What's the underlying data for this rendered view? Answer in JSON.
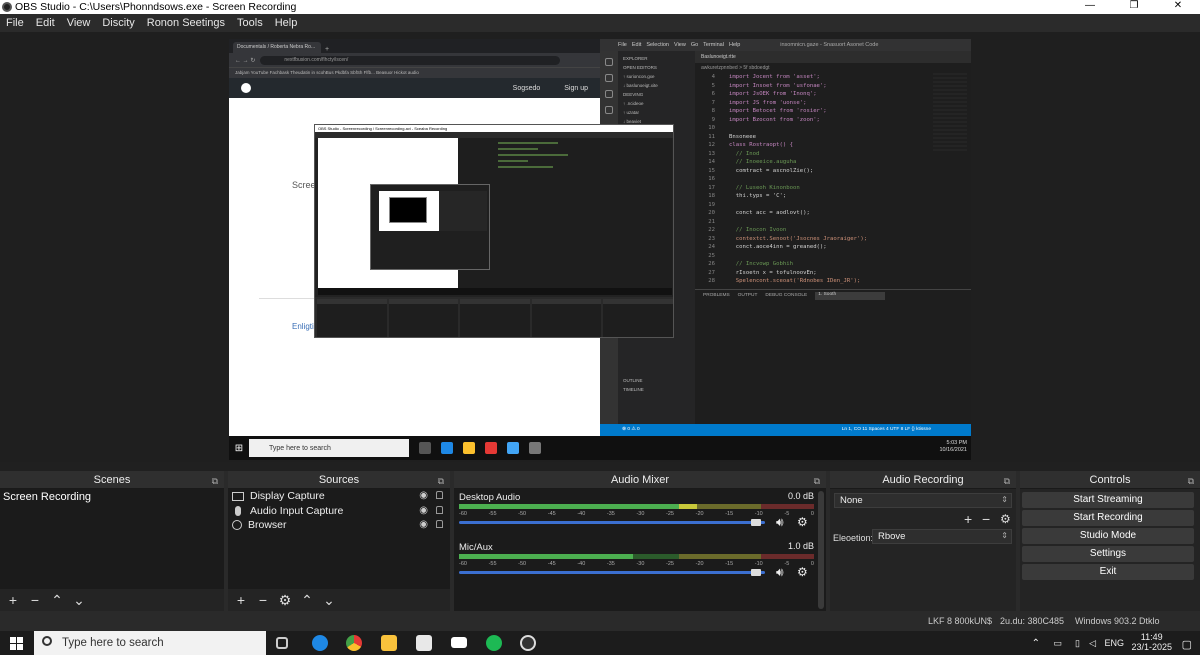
{
  "window": {
    "title": "OBS Studio - C:\\Users\\Phonndsows.exe - Screen Recording",
    "minimize": "—",
    "maximize": "❐",
    "close": "✕"
  },
  "menu": [
    "File",
    "Edit",
    "View",
    "Discity",
    "Ronon Seetings",
    "Tools",
    "Help"
  ],
  "preview": {
    "browser": {
      "tab_label": "Documentals / Roberta Nebra Ro...",
      "url": "nextfbusion.com/flhcty/iscen/",
      "bookmarks": "Jabjam    YouTube    Fachbask    Theudatin in scohBus    Pkdbfa SbfSh Flfb...    Beasuor Hickot audio",
      "header_links": [
        "Sogsedo",
        "Sign up"
      ],
      "page_text": "Screen",
      "page_link": "Enligti"
    },
    "code": {
      "menu": [
        "File",
        "Edit",
        "Selection",
        "View",
        "Go",
        "Terminal",
        "Help"
      ],
      "window_title": "insomnicn.gaze - Snasuort Asonet Code",
      "tab": "Baslunoeigt.rtte",
      "crumb": "awkuretzpnnbed  >  5f  sbdoedgt",
      "sidebar": [
        "EXPLORER",
        "OPEN EDITORS",
        "  ↑ surioncon.gxe",
        "  ↓ baslunoeigt.xite",
        "DEEVING",
        "  ↑ .ncideoe",
        "  ↑ uzatar",
        "  ↓ beaviet",
        "OUTLINE",
        "TIMELINE"
      ],
      "code_lines": [
        {
          "n": "4",
          "t": "import Jocent from 'asset';",
          "c": "kw"
        },
        {
          "n": "5",
          "t": "import Insoet from 'usfonae';",
          "c": "kw"
        },
        {
          "n": "6",
          "t": "import JsOEK from 'Inonq';",
          "c": "kw"
        },
        {
          "n": "7",
          "t": "import JS from 'uonse';",
          "c": "kw"
        },
        {
          "n": "8",
          "t": "import Betocet from 'rosier';",
          "c": "kw"
        },
        {
          "n": "9",
          "t": "import Bzocont from 'zoon';",
          "c": "kw"
        },
        {
          "n": "10",
          "t": "",
          "c": ""
        },
        {
          "n": "11",
          "t": "Bnsoneee",
          "c": ""
        },
        {
          "n": "12",
          "t": "class Rostraopt() {",
          "c": "kw"
        },
        {
          "n": "13",
          "t": "  // Inod",
          "c": "cm"
        },
        {
          "n": "14",
          "t": "  // Inoeeice.auguha",
          "c": "cm"
        },
        {
          "n": "15",
          "t": "  comtract = ascnolZie();",
          "c": ""
        },
        {
          "n": "16",
          "t": "",
          "c": ""
        },
        {
          "n": "17",
          "t": "  // Luseoh Kinonboon",
          "c": "cm"
        },
        {
          "n": "18",
          "t": "  thi.typs = 'C';",
          "c": ""
        },
        {
          "n": "19",
          "t": "",
          "c": ""
        },
        {
          "n": "20",
          "t": "  conct acc = aodlovt();",
          "c": ""
        },
        {
          "n": "21",
          "t": "",
          "c": ""
        },
        {
          "n": "22",
          "t": "  // Inocon Ivoon",
          "c": "cm"
        },
        {
          "n": "23",
          "t": "  contextct.Senoot('Jsocnes Jraoraiger');",
          "c": "st"
        },
        {
          "n": "24",
          "t": "  conct.aoce4inn = greaned();",
          "c": ""
        },
        {
          "n": "25",
          "t": "",
          "c": ""
        },
        {
          "n": "26",
          "t": "  // Incvowp Gobhih",
          "c": "cm"
        },
        {
          "n": "27",
          "t": "  rIsoetn x = tofulnoovEn;",
          "c": ""
        },
        {
          "n": "28",
          "t": "  Spelencont.sceoat('Rdnobes IDen_JR');",
          "c": "st"
        }
      ],
      "panel_tabs": [
        "PROBLEMS",
        "OUTPUT",
        "DEBUG CONSOLE"
      ],
      "panel_select": "1. Sooth",
      "status_left": "⊗ 0 ⚠ 0",
      "status_right": "Ln 1, CO 11   Spaces 4   UTF 8   LF   {} ktissne"
    },
    "taskbar": {
      "search": "Type here to search",
      "time": "5:03 PM",
      "date": "10/16/2021"
    },
    "nested_title": "OBS Studio - Screenrecording / Screenrecording.avi - Sceaba Recording"
  },
  "scenes": {
    "title": "Scenes",
    "items": [
      "Screen Recording"
    ]
  },
  "sources": {
    "title": "Sources",
    "items": [
      {
        "label": "Display Capture",
        "icon": "monitor-icon"
      },
      {
        "label": "Audio Input Capture",
        "icon": "microphone-icon"
      },
      {
        "label": "Browser",
        "icon": "globe-icon"
      }
    ]
  },
  "mixer": {
    "title": "Audio Mixer",
    "channels": [
      {
        "name": "Desktop Audio",
        "db": "0.0 dB",
        "level": 0.67,
        "volume": 0.97
      },
      {
        "name": "Mic/Aux",
        "db": "1.0 dB",
        "level": 0.49,
        "volume": 0.97
      }
    ],
    "ticks": [
      "-60",
      "-55",
      "-50",
      "-45",
      "-40",
      "-35",
      "-30",
      "-25",
      "-20",
      "-15",
      "-10",
      "-5",
      "0"
    ]
  },
  "recording": {
    "title": "Audio Recording",
    "select_value": "None",
    "field_label": "Eleoetion:",
    "field_value": "Rbove"
  },
  "controls": {
    "title": "Controls",
    "buttons": [
      "Start Streaming",
      "Start Recording",
      "Studio Mode",
      "Settings",
      "Exit"
    ]
  },
  "status": {
    "left": "LKF 8 800kUN$",
    "middle": "2u.du: 380C485",
    "right": "Windows 903.2 Dtklo"
  },
  "taskbar": {
    "search": "Type here to search",
    "lang": "ENG",
    "time": "11:49",
    "date": "23/1-2025"
  },
  "colors": {
    "accent": "#3b6fd1",
    "meter_green": "#4caf50",
    "meter_yellow": "#c8c83a",
    "meter_red": "#c84a3a"
  }
}
